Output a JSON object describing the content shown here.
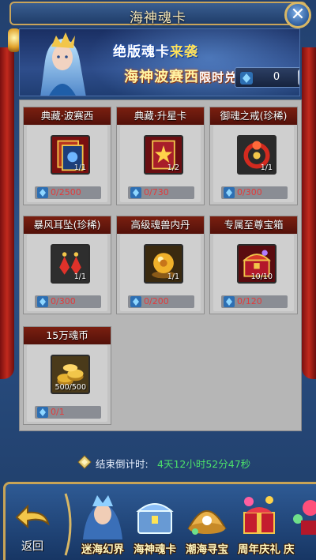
{
  "header": {
    "title": "海神魂卡"
  },
  "banner": {
    "line1": "绝版魂卡",
    "line1_suffix": "来袭",
    "line2": "海神波赛西",
    "line2_suffix": "限时兑换",
    "currency_value": "0",
    "plus_label": "+"
  },
  "items": [
    {
      "name": "典藏·波赛西",
      "qty": "1/1",
      "price": "0/2500",
      "icon": "card-icon"
    },
    {
      "name": "典藏·升星卡",
      "qty": "1/2",
      "price": "0/730",
      "icon": "star-card-icon"
    },
    {
      "name": "御魂之戒(珍稀)",
      "qty": "1/1",
      "price": "0/300",
      "icon": "ring-icon"
    },
    {
      "name": "暴风耳坠(珍稀)",
      "qty": "1/1",
      "price": "0/300",
      "icon": "earring-icon"
    },
    {
      "name": "高级魂兽内丹",
      "qty": "1/1",
      "price": "0/200",
      "icon": "orb-icon"
    },
    {
      "name": "专属至尊宝箱",
      "qty": "10/10",
      "price": "0/120",
      "icon": "chest-icon"
    },
    {
      "name": "15万魂币",
      "qty": "500/500",
      "price": "0/1",
      "icon": "coins-icon"
    }
  ],
  "countdown": {
    "label": "结束倒计时:",
    "value": "4天12小时52分47秒"
  },
  "tabbar": {
    "back_label": "返回",
    "tabs": [
      {
        "label": "迷海幻界"
      },
      {
        "label": "海神魂卡"
      },
      {
        "label": "潮海寻宝"
      },
      {
        "label": "周年庆礼"
      },
      {
        "label": "庆"
      }
    ]
  },
  "colors": {
    "price_text": "#e33b3b",
    "countdown_value": "#4ce26a",
    "item_header": "#6a1a0e",
    "gold_border": "#c9a45a"
  }
}
